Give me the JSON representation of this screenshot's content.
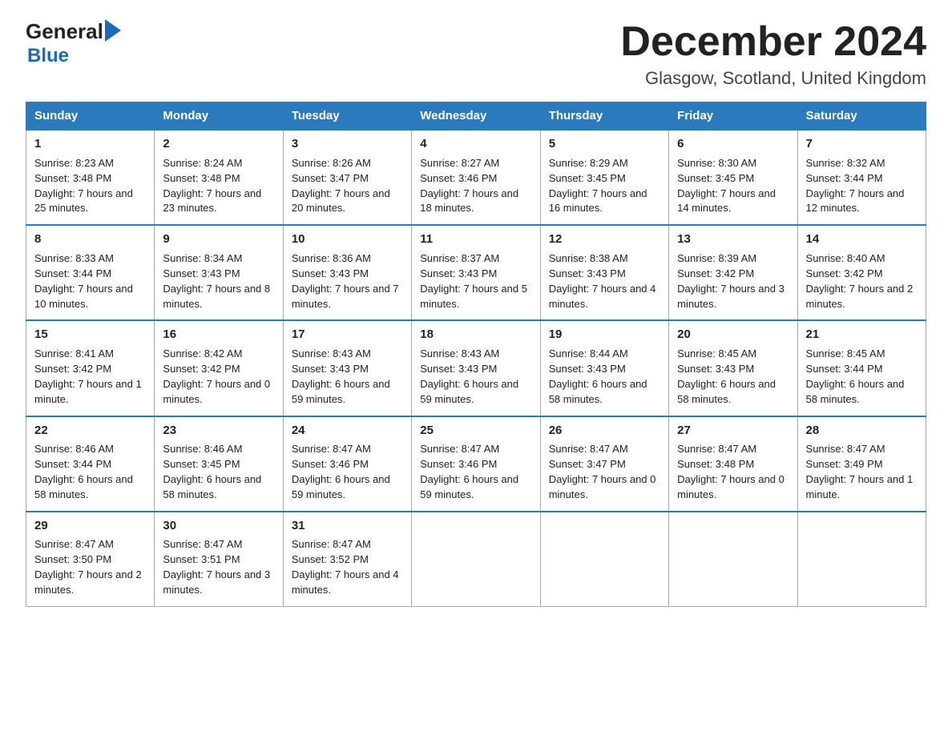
{
  "logo": {
    "general": "General",
    "arrow": "▶",
    "blue": "Blue"
  },
  "title": "December 2024",
  "location": "Glasgow, Scotland, United Kingdom",
  "weekdays": [
    "Sunday",
    "Monday",
    "Tuesday",
    "Wednesday",
    "Thursday",
    "Friday",
    "Saturday"
  ],
  "weeks": [
    [
      {
        "day": "1",
        "sunrise": "8:23 AM",
        "sunset": "3:48 PM",
        "daylight": "7 hours and 25 minutes."
      },
      {
        "day": "2",
        "sunrise": "8:24 AM",
        "sunset": "3:48 PM",
        "daylight": "7 hours and 23 minutes."
      },
      {
        "day": "3",
        "sunrise": "8:26 AM",
        "sunset": "3:47 PM",
        "daylight": "7 hours and 20 minutes."
      },
      {
        "day": "4",
        "sunrise": "8:27 AM",
        "sunset": "3:46 PM",
        "daylight": "7 hours and 18 minutes."
      },
      {
        "day": "5",
        "sunrise": "8:29 AM",
        "sunset": "3:45 PM",
        "daylight": "7 hours and 16 minutes."
      },
      {
        "day": "6",
        "sunrise": "8:30 AM",
        "sunset": "3:45 PM",
        "daylight": "7 hours and 14 minutes."
      },
      {
        "day": "7",
        "sunrise": "8:32 AM",
        "sunset": "3:44 PM",
        "daylight": "7 hours and 12 minutes."
      }
    ],
    [
      {
        "day": "8",
        "sunrise": "8:33 AM",
        "sunset": "3:44 PM",
        "daylight": "7 hours and 10 minutes."
      },
      {
        "day": "9",
        "sunrise": "8:34 AM",
        "sunset": "3:43 PM",
        "daylight": "7 hours and 8 minutes."
      },
      {
        "day": "10",
        "sunrise": "8:36 AM",
        "sunset": "3:43 PM",
        "daylight": "7 hours and 7 minutes."
      },
      {
        "day": "11",
        "sunrise": "8:37 AM",
        "sunset": "3:43 PM",
        "daylight": "7 hours and 5 minutes."
      },
      {
        "day": "12",
        "sunrise": "8:38 AM",
        "sunset": "3:43 PM",
        "daylight": "7 hours and 4 minutes."
      },
      {
        "day": "13",
        "sunrise": "8:39 AM",
        "sunset": "3:42 PM",
        "daylight": "7 hours and 3 minutes."
      },
      {
        "day": "14",
        "sunrise": "8:40 AM",
        "sunset": "3:42 PM",
        "daylight": "7 hours and 2 minutes."
      }
    ],
    [
      {
        "day": "15",
        "sunrise": "8:41 AM",
        "sunset": "3:42 PM",
        "daylight": "7 hours and 1 minute."
      },
      {
        "day": "16",
        "sunrise": "8:42 AM",
        "sunset": "3:42 PM",
        "daylight": "7 hours and 0 minutes."
      },
      {
        "day": "17",
        "sunrise": "8:43 AM",
        "sunset": "3:43 PM",
        "daylight": "6 hours and 59 minutes."
      },
      {
        "day": "18",
        "sunrise": "8:43 AM",
        "sunset": "3:43 PM",
        "daylight": "6 hours and 59 minutes."
      },
      {
        "day": "19",
        "sunrise": "8:44 AM",
        "sunset": "3:43 PM",
        "daylight": "6 hours and 58 minutes."
      },
      {
        "day": "20",
        "sunrise": "8:45 AM",
        "sunset": "3:43 PM",
        "daylight": "6 hours and 58 minutes."
      },
      {
        "day": "21",
        "sunrise": "8:45 AM",
        "sunset": "3:44 PM",
        "daylight": "6 hours and 58 minutes."
      }
    ],
    [
      {
        "day": "22",
        "sunrise": "8:46 AM",
        "sunset": "3:44 PM",
        "daylight": "6 hours and 58 minutes."
      },
      {
        "day": "23",
        "sunrise": "8:46 AM",
        "sunset": "3:45 PM",
        "daylight": "6 hours and 58 minutes."
      },
      {
        "day": "24",
        "sunrise": "8:47 AM",
        "sunset": "3:46 PM",
        "daylight": "6 hours and 59 minutes."
      },
      {
        "day": "25",
        "sunrise": "8:47 AM",
        "sunset": "3:46 PM",
        "daylight": "6 hours and 59 minutes."
      },
      {
        "day": "26",
        "sunrise": "8:47 AM",
        "sunset": "3:47 PM",
        "daylight": "7 hours and 0 minutes."
      },
      {
        "day": "27",
        "sunrise": "8:47 AM",
        "sunset": "3:48 PM",
        "daylight": "7 hours and 0 minutes."
      },
      {
        "day": "28",
        "sunrise": "8:47 AM",
        "sunset": "3:49 PM",
        "daylight": "7 hours and 1 minute."
      }
    ],
    [
      {
        "day": "29",
        "sunrise": "8:47 AM",
        "sunset": "3:50 PM",
        "daylight": "7 hours and 2 minutes."
      },
      {
        "day": "30",
        "sunrise": "8:47 AM",
        "sunset": "3:51 PM",
        "daylight": "7 hours and 3 minutes."
      },
      {
        "day": "31",
        "sunrise": "8:47 AM",
        "sunset": "3:52 PM",
        "daylight": "7 hours and 4 minutes."
      },
      null,
      null,
      null,
      null
    ]
  ],
  "labels": {
    "sunrise": "Sunrise:",
    "sunset": "Sunset:",
    "daylight": "Daylight:"
  }
}
